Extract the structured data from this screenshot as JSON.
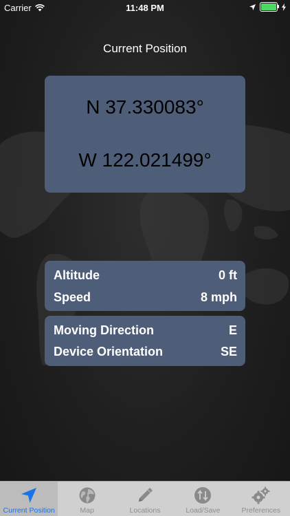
{
  "status_bar": {
    "carrier": "Carrier",
    "time": "11:48 PM",
    "battery_level": 1.0,
    "battery_color": "#4cd964"
  },
  "header": {
    "title": "Current Position"
  },
  "coordinates": {
    "latitude": "N 37.330083°",
    "longitude": "W 122.021499°"
  },
  "motion": {
    "altitude_label": "Altitude",
    "altitude_value": "0 ft",
    "speed_label": "Speed",
    "speed_value": "8 mph"
  },
  "orientation": {
    "moving_direction_label": "Moving Direction",
    "moving_direction_value": "E",
    "device_orientation_label": "Device Orientation",
    "device_orientation_value": "SE"
  },
  "tab_bar": {
    "selected": "Current Position",
    "accent_color": "#1a73e8",
    "tabs": [
      {
        "label": "Current Position",
        "icon": "location-arrow-icon"
      },
      {
        "label": "Map",
        "icon": "globe-icon"
      },
      {
        "label": "Locations",
        "icon": "pencil-icon"
      },
      {
        "label": "Load/Save",
        "icon": "sync-arrows-icon"
      },
      {
        "label": "Preferences",
        "icon": "gears-icon"
      }
    ]
  },
  "colors": {
    "card_background": "#4f5e78",
    "screen_background": "#1f1f1f",
    "tab_bar_background": "#d0d0d0"
  }
}
